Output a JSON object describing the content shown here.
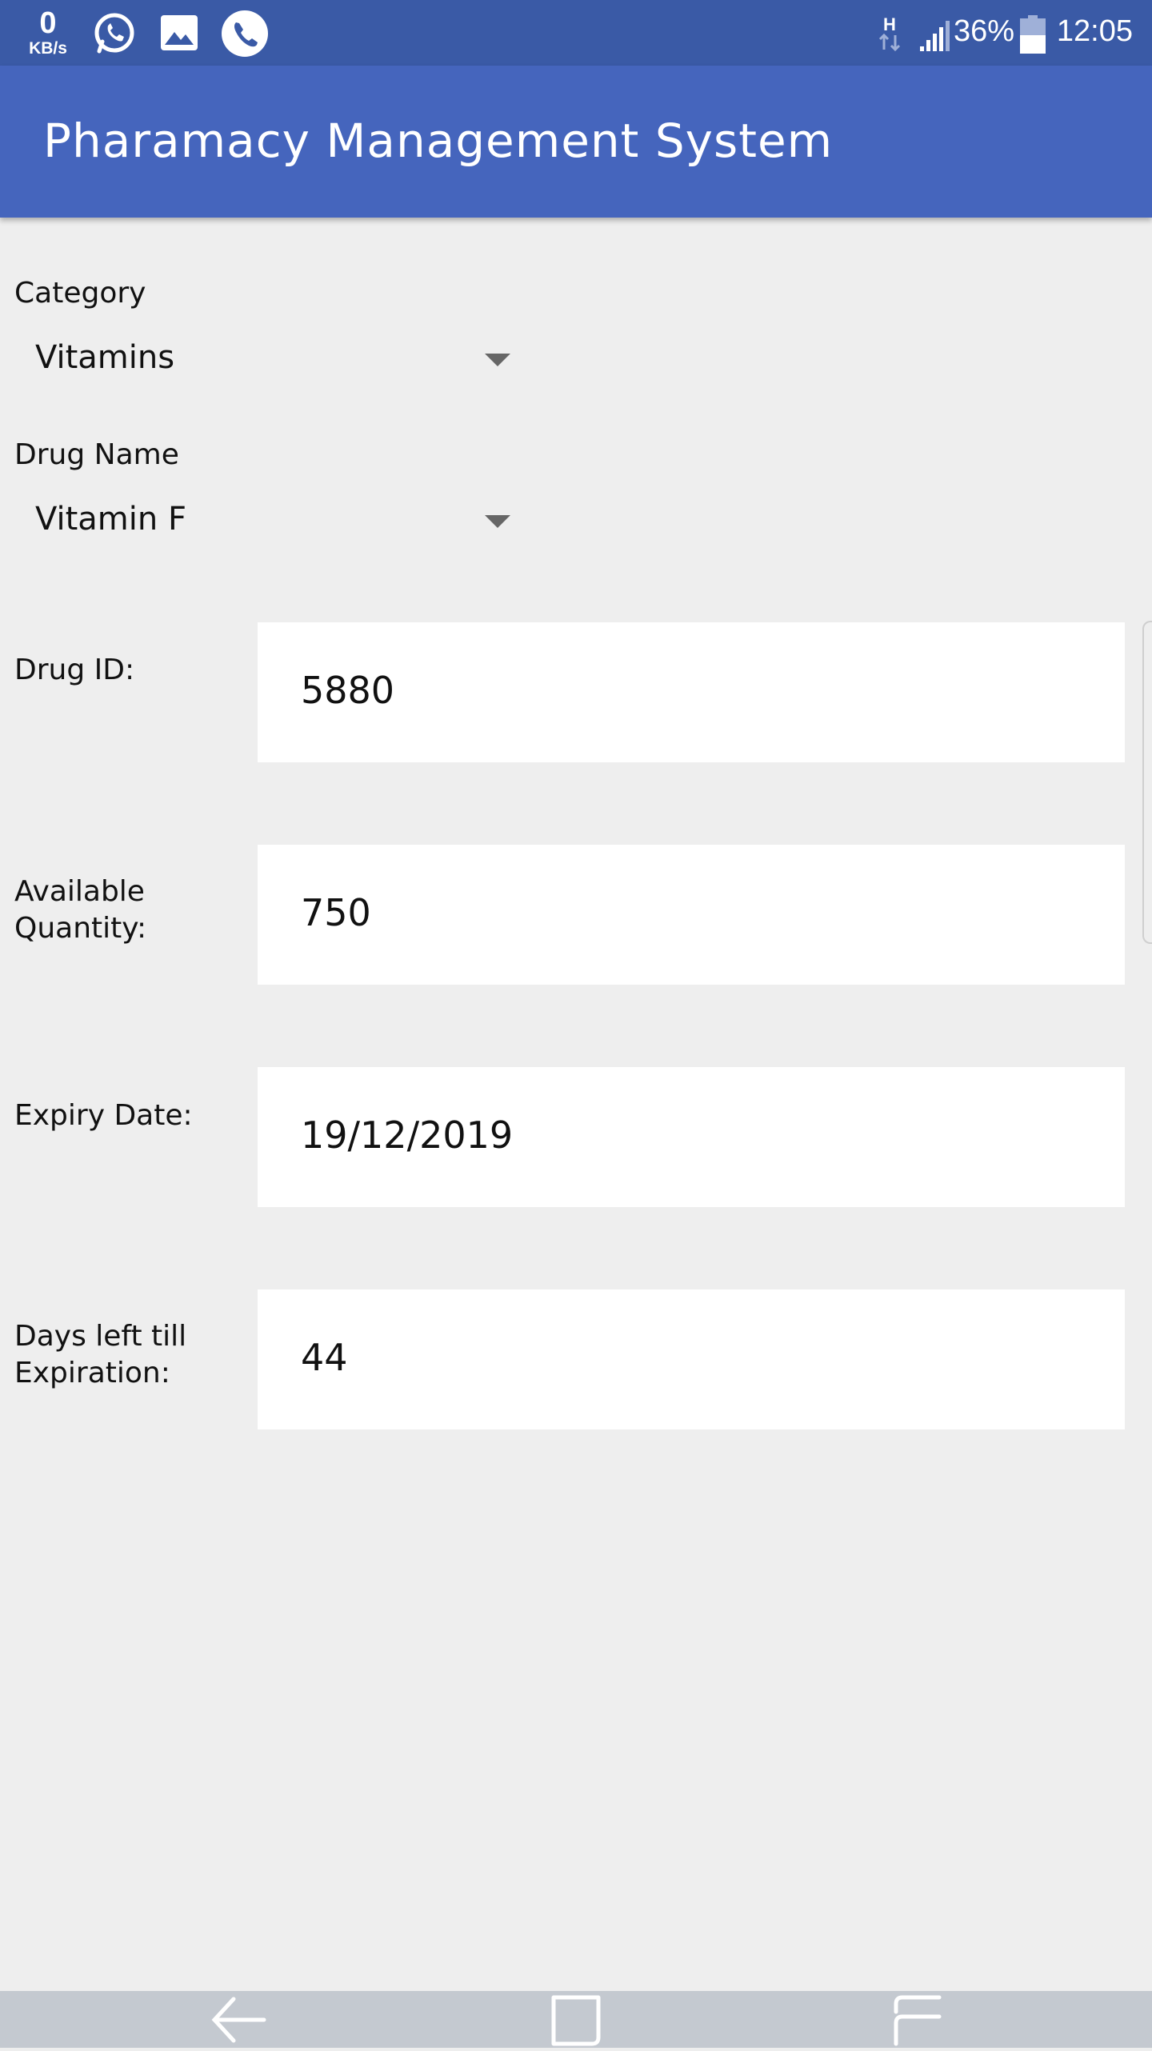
{
  "status_bar": {
    "net_speed_value": "0",
    "net_speed_unit": "KB/s",
    "notification_icons": [
      "whatsapp-icon",
      "gallery-icon",
      "phone-icon"
    ],
    "network_type": "H",
    "battery_percent": "36%",
    "time": "12:05"
  },
  "app_bar": {
    "title": "Pharamacy Management System"
  },
  "form": {
    "category": {
      "label": "Category",
      "value": "Vitamins"
    },
    "drug_name": {
      "label": "Drug Name",
      "value": "Vitamin F"
    },
    "drug_id": {
      "label": "Drug ID:",
      "value": "5880"
    },
    "available_quantity": {
      "label_line1": "Available",
      "label_line2": "Quantity:",
      "value": "750"
    },
    "expiry_date": {
      "label": "Expiry Date:",
      "value": "19/12/2019"
    },
    "days_left": {
      "label_line1": "Days left till",
      "label_line2": "Expiration:",
      "value": "44"
    }
  },
  "nav_bar": {
    "buttons": [
      "back-icon",
      "home-icon",
      "recents-icon"
    ]
  },
  "colors": {
    "status_bar": "#3a5aa6",
    "app_bar": "#4565bd",
    "background": "#eeeeee",
    "field": "#ffffff",
    "nav_bar": "#c4c9d0"
  }
}
